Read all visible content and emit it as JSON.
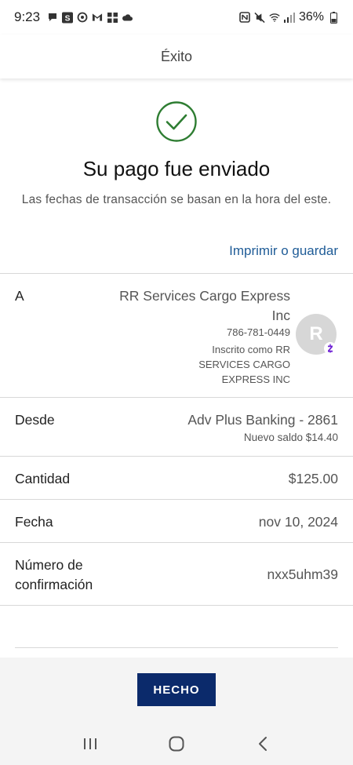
{
  "status_bar": {
    "time": "9:23",
    "battery": "36%",
    "left_icons": [
      "chat-bubble-icon",
      "s-app-icon",
      "sync-icon",
      "gmail-icon",
      "grid-app-icon",
      "cloud-icon"
    ],
    "right_icons": [
      "nfc-icon",
      "mute-icon",
      "wifi-icon",
      "signal-icon",
      "battery-icon"
    ]
  },
  "header": {
    "title": "Éxito"
  },
  "success": {
    "icon": "check-circle-icon",
    "icon_color": "#2e7d32",
    "headline": "Su pago fue enviado",
    "subtext": "Las fechas de transacción se basan en la hora del este."
  },
  "print_link": "Imprimir o guardar",
  "details": {
    "recipient": {
      "label": "A",
      "name": "RR Services Cargo Express Inc",
      "phone": "786-781-0449",
      "enrolled": "Inscrito como RR SERVICES CARGO EXPRESS INC",
      "avatar_letter": "R",
      "badge_icon": "zelle-icon"
    },
    "from": {
      "label": "Desde",
      "account": "Adv Plus Banking - 2861",
      "new_balance": "Nuevo saldo $14.40"
    },
    "amount": {
      "label": "Cantidad",
      "value": "$125.00"
    },
    "date": {
      "label": "Fecha",
      "value": "nov 10, 2024"
    },
    "confirmation": {
      "label_line1": "Número de",
      "label_line2": "confirmación",
      "value": "nxx5uhm39"
    }
  },
  "done_button": "HECHO",
  "colors": {
    "link": "#1f5c97",
    "button": "#0b2a6b",
    "zelle": "#6d1ed4"
  },
  "nav": [
    "recents-icon",
    "home-icon",
    "back-icon"
  ]
}
